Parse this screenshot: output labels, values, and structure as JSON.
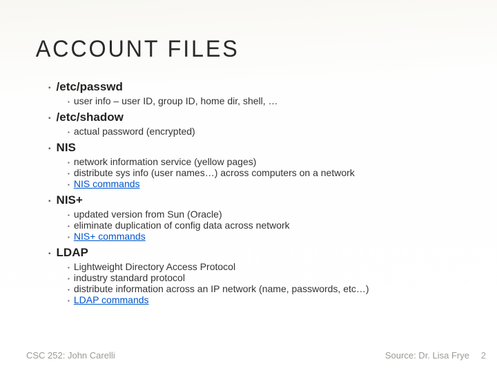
{
  "title": "ACCOUNT FILES",
  "sections": [
    {
      "heading": "/etc/passwd",
      "items": [
        "user info – user ID, group ID, home dir, shell, …"
      ],
      "links": [
        false
      ]
    },
    {
      "heading": "/etc/shadow",
      "items": [
        "actual password (encrypted)"
      ],
      "links": [
        false
      ]
    },
    {
      "heading": "NIS",
      "items": [
        "network information service (yellow pages)",
        "distribute sys info (user names…) across computers on a network",
        "NIS commands"
      ],
      "links": [
        false,
        false,
        true
      ]
    },
    {
      "heading": "NIS+",
      "items": [
        "updated version from Sun (Oracle)",
        "eliminate duplication of config data across network",
        "NIS+ commands"
      ],
      "links": [
        false,
        false,
        true
      ]
    },
    {
      "heading": "LDAP",
      "items": [
        "Lightweight Directory Access Protocol",
        "industry standard protocol",
        "distribute information across an IP network (name, passwords, etc…)",
        "LDAP commands"
      ],
      "links": [
        false,
        false,
        false,
        true
      ]
    }
  ],
  "footer_left": "CSC 252: John Carelli",
  "footer_right": "Source: Dr. Lisa Frye",
  "page_number": "2",
  "bullet": "▪"
}
